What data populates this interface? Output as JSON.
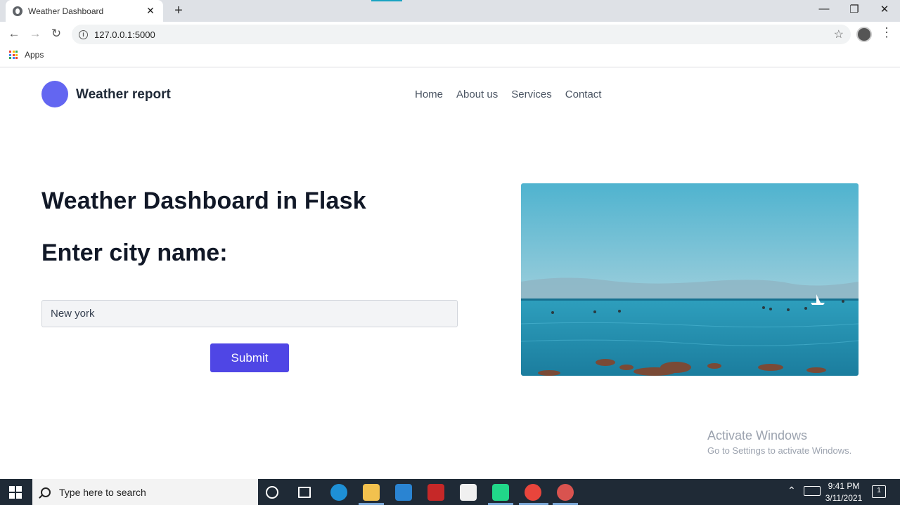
{
  "browser": {
    "tab_title": "Weather Dashboard",
    "tab_close": "✕",
    "new_tab": "+",
    "url": "127.0.0.1:5000",
    "bookmarks_apps": "Apps",
    "window_controls": {
      "minimize": "—",
      "maximize": "❐",
      "close": "✕"
    }
  },
  "header": {
    "brand": "Weather report",
    "nav": [
      "Home",
      "About us",
      "Services",
      "Contact"
    ]
  },
  "main": {
    "title": "Weather Dashboard in Flask",
    "subtitle": "Enter city name:",
    "city_input_value": "New york",
    "submit_label": "Submit",
    "hero_image": "ocean-coast-photo"
  },
  "watermark": {
    "line1": "Activate Windows",
    "line2": "Go to Settings to activate Windows."
  },
  "taskbar": {
    "search_placeholder": "Type here to search",
    "time": "9:41 PM",
    "date": "3/11/2021",
    "notification_count": "1"
  },
  "colors": {
    "brand_circle": "#6366f1",
    "submit_button": "#4f46e5",
    "taskbar": "#1f2a36"
  }
}
